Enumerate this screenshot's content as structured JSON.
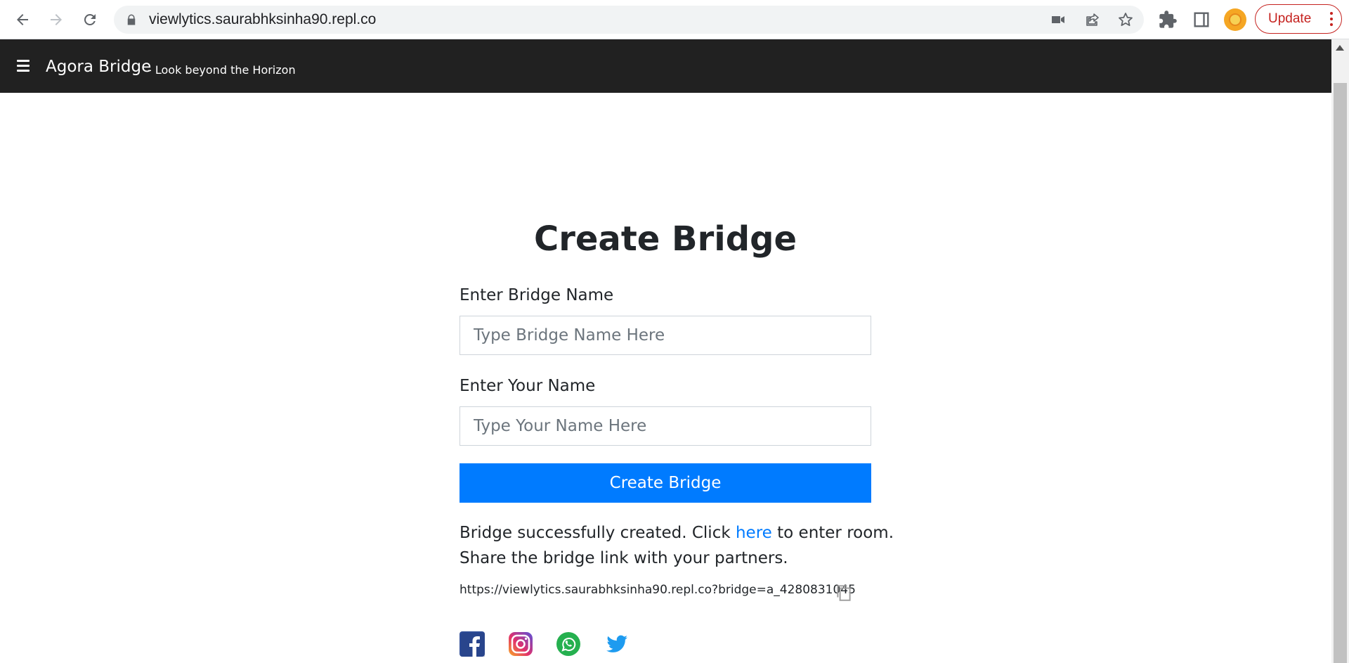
{
  "browser": {
    "url": "viewlytics.saurabhksinha90.repl.co",
    "update_label": "Update",
    "icons": [
      "back-icon",
      "forward-icon",
      "reload-icon",
      "lock-icon",
      "camera-icon",
      "share-icon",
      "star-icon",
      "extensions-icon",
      "side-panel-icon",
      "profile-avatar",
      "more-icon"
    ]
  },
  "navbar": {
    "brand": "Agora Bridge",
    "tagline": "- Look beyond the Horizon"
  },
  "form": {
    "title": "Create Bridge",
    "bridge_name_label": "Enter Bridge Name",
    "bridge_name_placeholder": "Type Bridge Name Here",
    "your_name_label": "Enter Your Name",
    "your_name_placeholder": "Type Your Name Here",
    "submit_label": "Create Bridge"
  },
  "result": {
    "line1_before": "Bridge successfully created. Click ",
    "line1_link": "here",
    "line1_after": " to enter room.",
    "line2": "Share the bridge link with your partners.",
    "share_url": "https://viewlytics.saurabhksinha90.repl.co?bridge=a_4280831045"
  },
  "social": [
    "facebook-icon",
    "instagram-icon",
    "whatsapp-icon",
    "twitter-icon"
  ],
  "colors": {
    "navbar": "#212121",
    "primary": "#007bff",
    "update": "#c5221f"
  }
}
